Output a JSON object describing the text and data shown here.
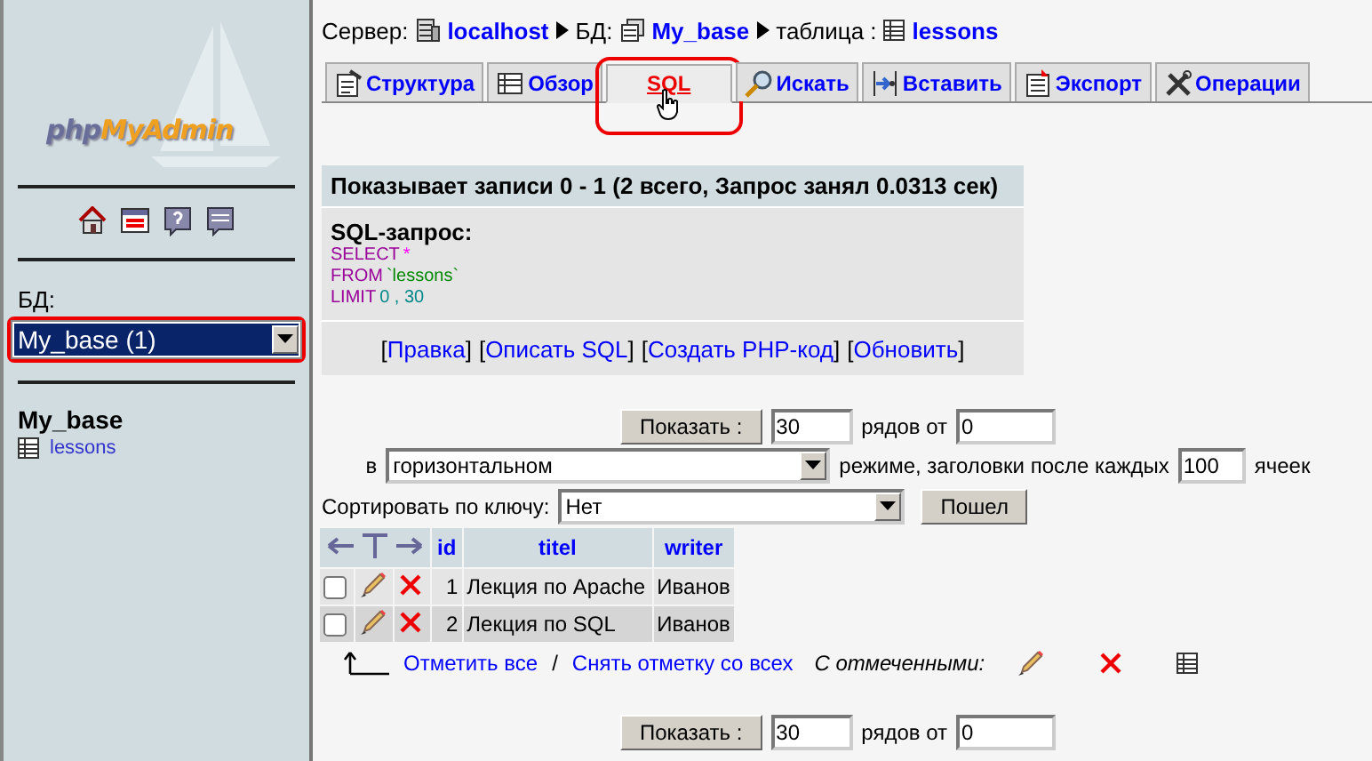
{
  "sidebar": {
    "logo": [
      "php",
      "MyAdmin"
    ],
    "db_label": "БД:",
    "db_select": {
      "value": "My_base (1)",
      "highlighted": true
    },
    "db_name": "My_base",
    "tables": [
      "lessons"
    ]
  },
  "breadcrumb": [
    {
      "label": "Сервер:",
      "value": "localhost",
      "kind": "server"
    },
    {
      "label": "БД:",
      "value": "My_base",
      "kind": "database"
    },
    {
      "label": "таблица :",
      "value": "lessons",
      "kind": "table"
    }
  ],
  "tabs": [
    {
      "label": "Структура",
      "kind": "structure",
      "selected": false,
      "highlighted": false
    },
    {
      "label": "Обзор",
      "kind": "browse",
      "selected": false,
      "highlighted": false
    },
    {
      "label": "SQL",
      "kind": "sql",
      "selected": true,
      "highlighted": true
    },
    {
      "label": "Искать",
      "kind": "search",
      "selected": false,
      "highlighted": false
    },
    {
      "label": "Вставить",
      "kind": "insert",
      "selected": false,
      "highlighted": false
    },
    {
      "label": "Экспорт",
      "kind": "export",
      "selected": false,
      "highlighted": false
    },
    {
      "label": "Операции",
      "kind": "operations",
      "selected": false,
      "highlighted": false
    }
  ],
  "result_message": "Показывает записи 0 - 1 (2 всего, Запрос занял 0.0313 сек)",
  "sql_query": {
    "title": "SQL-запрос:",
    "lines": [
      [
        {
          "text": "SELECT",
          "kind": "keyword"
        },
        {
          "text": "*",
          "kind": "operator"
        }
      ],
      [
        {
          "text": "FROM",
          "kind": "keyword"
        },
        {
          "text": "`lessons`",
          "kind": "identifier"
        }
      ],
      [
        {
          "text": "LIMIT",
          "kind": "keyword"
        },
        {
          "text": "0 , 30",
          "kind": "number"
        }
      ]
    ]
  },
  "query_links": [
    {
      "before": "[",
      "text": "Правка",
      "after": "]"
    },
    {
      "before": "[",
      "text": "Описать SQL",
      "after": "]"
    },
    {
      "before": "[",
      "text": "Создать PHP-код",
      "after": "]"
    },
    {
      "before": "[",
      "text": "Обновить",
      "after": "]"
    }
  ],
  "navigation": {
    "show_button": "Показать :",
    "rows": "30",
    "rows_label": "рядов от",
    "start": "0",
    "mode_prefix": "в",
    "mode": "горизонтальном",
    "mode_label": "режиме, заголовки после каждых",
    "repeat": "100",
    "repeat_label": "ячеек"
  },
  "sort": {
    "label": "Сортировать по ключу:",
    "value": "Нет",
    "button": "Пошел"
  },
  "table": {
    "columns": [
      "id",
      "titel",
      "writer"
    ],
    "rows": [
      {
        "cells": [
          "1",
          "Лекция по Apache",
          "Иванов"
        ],
        "checked": false
      },
      {
        "cells": [
          "2",
          "Лекция по SQL",
          "Иванов"
        ],
        "checked": false
      }
    ]
  },
  "bulk": {
    "check_all": "Отметить все",
    "separator": "/",
    "uncheck_all": "Снять отметку со всех",
    "with_selected": "С отмеченными:"
  },
  "bottom_navigation": {
    "show_button": "Показать :",
    "rows": "30",
    "rows_label": "рядов от",
    "start": "0"
  }
}
